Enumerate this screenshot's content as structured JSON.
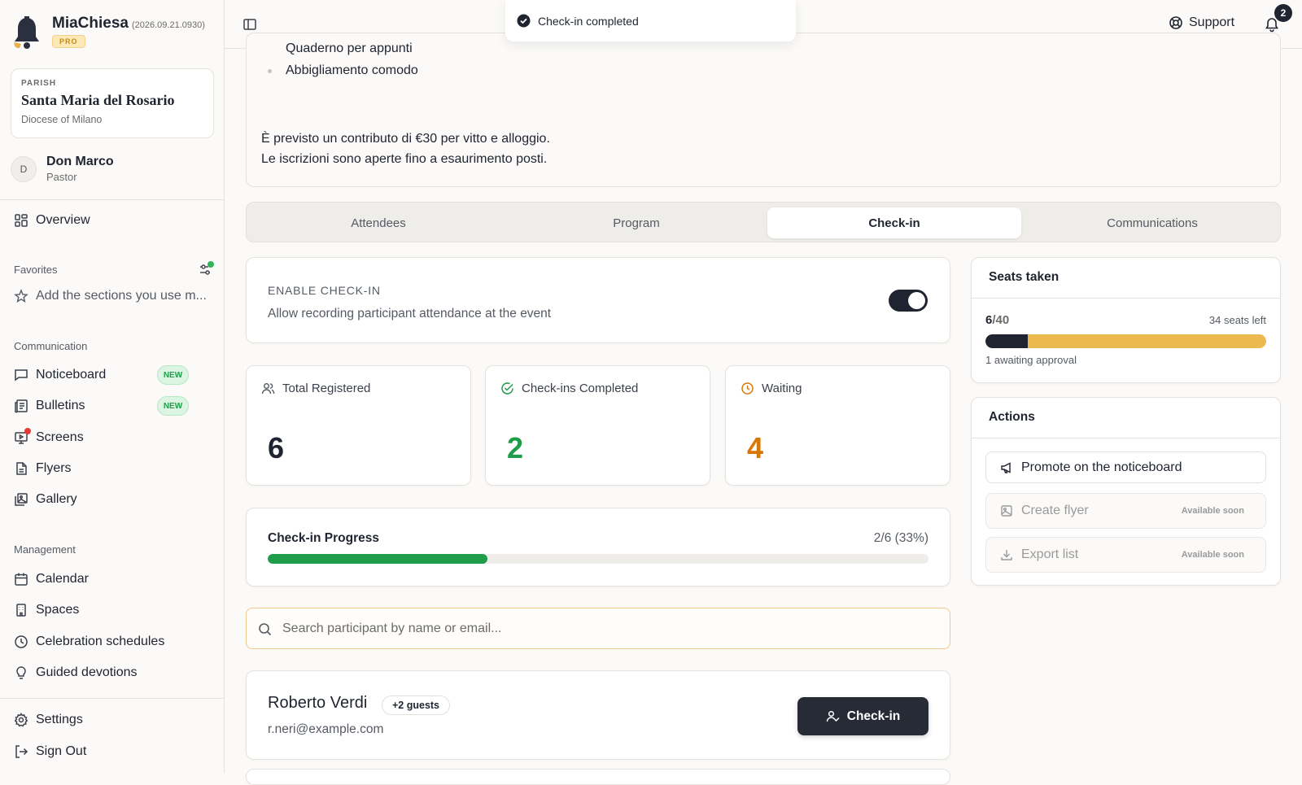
{
  "app": {
    "name": "MiaChiesa",
    "version": "(2026.09.21.0930)",
    "plan_badge": "PRO"
  },
  "parish": {
    "label": "PARISH",
    "name": "Santa Maria del Rosario",
    "diocese": "Diocese of Milano"
  },
  "user": {
    "initial": "D",
    "name": "Don Marco",
    "role": "Pastor"
  },
  "sidebar": {
    "overview": "Overview",
    "favorites_label": "Favorites",
    "favorites_add": "Add the sections you use m...",
    "communication_label": "Communication",
    "communication_items": [
      {
        "label": "Noticeboard",
        "badge": "NEW"
      },
      {
        "label": "Bulletins",
        "badge": "NEW"
      },
      {
        "label": "Screens"
      },
      {
        "label": "Flyers"
      },
      {
        "label": "Gallery"
      }
    ],
    "management_label": "Management",
    "management_items": [
      {
        "label": "Calendar"
      },
      {
        "label": "Spaces"
      },
      {
        "label": "Celebration schedules"
      },
      {
        "label": "Guided devotions"
      }
    ],
    "settings": "Settings",
    "sign_out": "Sign Out"
  },
  "topbar": {
    "support": "Support",
    "notifications_count": "2"
  },
  "toast": {
    "message": "Check-in completed"
  },
  "description": {
    "cut_line": "Quaderno per appunti",
    "bullet": "Abbigliamento comodo",
    "para1": "È previsto un contributo di €30 per vitto e alloggio.",
    "para2": "Le iscrizioni sono aperte fino a esaurimento posti."
  },
  "tabs": [
    "Attendees",
    "Program",
    "Check-in",
    "Communications"
  ],
  "active_tab": "Check-in",
  "checkin": {
    "enable_title": "ENABLE CHECK-IN",
    "enable_desc": "Allow recording participant attendance at the event",
    "enabled": true
  },
  "stats": {
    "total_label": "Total Registered",
    "total_value": "6",
    "completed_label": "Check-ins Completed",
    "completed_value": "2",
    "waiting_label": "Waiting",
    "waiting_value": "4"
  },
  "progress": {
    "title": "Check-in Progress",
    "value_text": "2/6 (33%)",
    "fraction": 0.333
  },
  "search": {
    "placeholder": "Search participant by name or email..."
  },
  "participants": [
    {
      "name": "Roberto Verdi",
      "guests": "+2 guests",
      "email": "r.neri@example.com",
      "action": "Check-in"
    }
  ],
  "seats": {
    "title": "Seats taken",
    "taken": "6",
    "total": "/40",
    "left_text": "34 seats left",
    "awaiting_text": "1 awaiting approval",
    "fraction": 0.15
  },
  "actions": {
    "title": "Actions",
    "items": [
      {
        "label": "Promote on the noticeboard",
        "status": ""
      },
      {
        "label": "Create flyer",
        "status": "Available soon"
      },
      {
        "label": "Export list",
        "status": "Available soon"
      }
    ]
  },
  "colors": {
    "accent_dark": "#1f2430",
    "success": "#1f9d4a",
    "warning": "#d97706",
    "seats_bar": "#ecb94f"
  }
}
